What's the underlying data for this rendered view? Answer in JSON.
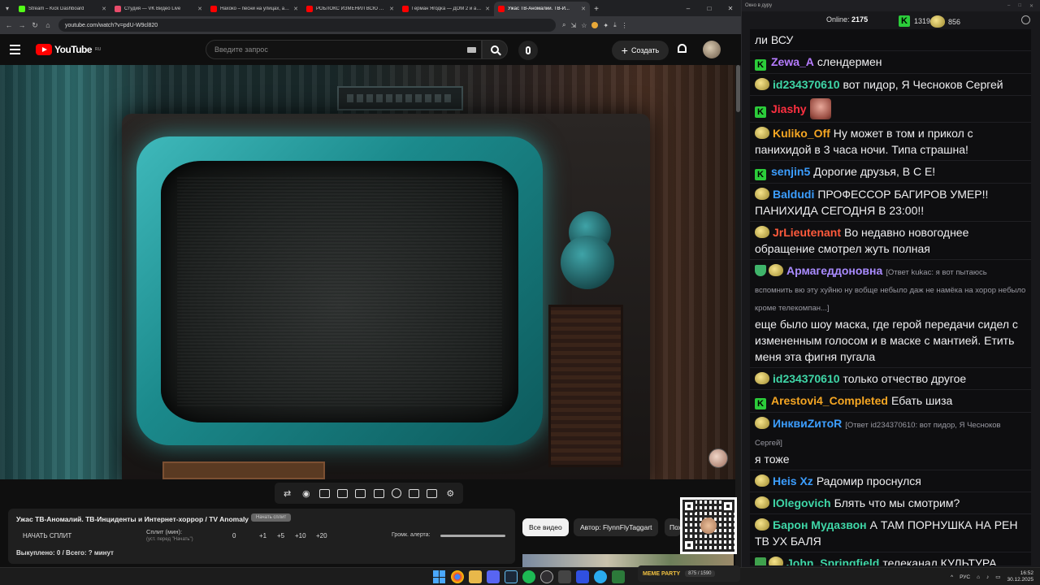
{
  "browser": {
    "tabs": [
      {
        "title": "Stream – Kick Dashboard",
        "color": "#53fc18"
      },
      {
        "title": "Студия — VK Видео Live",
        "color": "#e84c6b"
      },
      {
        "title": "Нахоко – песни на улицах, ар...",
        "color": "#ff0000"
      },
      {
        "title": "РОБЛОКС ИЗМЕНИЛ ВСЮ МО...",
        "color": "#ff0000"
      },
      {
        "title": "Герман Ягодка — ДОМ 2 и ал...",
        "color": "#ff0000"
      },
      {
        "title": "Ужас ТВ-Аномалий. ТВ-И...",
        "color": "#ff0000"
      }
    ],
    "url": "youtube.com/watch?v=pdU-W9cl820"
  },
  "youtube": {
    "logo": "YouTube",
    "region": "RU",
    "search_placeholder": "Введите запрос",
    "create_label": "Создать"
  },
  "split_panel": {
    "title": "Ужас ТВ-Аномалий. ТВ-Инциденты и Интернет-хоррор / TV Anomaly",
    "badge": "Начать сплит",
    "start_label": "НАЧАТЬ СПЛИТ",
    "split_label": "Сплит (мин):",
    "split_sub": "(уст. перед \"Начать\")",
    "split_value": "0",
    "increments": [
      "+1",
      "+5",
      "+10",
      "+20"
    ],
    "volume_label": "Громк. алерта:",
    "bought": "Выкуплено: 0 / Всего: ? минут"
  },
  "chips": {
    "all": "Все видео",
    "author": "Автор: FlynnFlyTaggart",
    "next": "Пох"
  },
  "chat": {
    "window_title": "Окно в дуру",
    "online_label": "Online:",
    "online_value": "2175",
    "kick_count": "1319",
    "other_count": "856",
    "messages": [
      {
        "badge": "none",
        "name": "",
        "color": "#ffffff",
        "text": "ли ВСУ"
      },
      {
        "badge": "k",
        "name": "Zewa_A",
        "color": "#b67cff",
        "text": "слендермен"
      },
      {
        "badge": "face",
        "name": "id234370610",
        "color": "#3fd6a7",
        "text": "вот пидор, Я Чесноков Сергей"
      },
      {
        "badge": "k",
        "name": "Jiashy",
        "color": "#ff3040",
        "text": ""
      },
      {
        "badge": "face",
        "name": "Kuliko_Off",
        "color": "#f5a623",
        "text": "Ну может в том и прикол с панихидой в 3 часа ночи. Типа страшна!"
      },
      {
        "badge": "k",
        "name": "senjin5",
        "color": "#3c9eff",
        "text": "Дорогие друзья, В С Е!"
      },
      {
        "badge": "face",
        "name": "Baldudi",
        "color": "#3c9eff",
        "text": "ПРОФЕССОР БАГИРОВ УМЕР!! ПАНИХИДА СЕГОДНЯ В 23:00!!"
      },
      {
        "badge": "face",
        "name": "JrLieutenant",
        "color": "#ff5a3c",
        "text": "Во недавно новогоднее обращение смотрел жуть полная"
      },
      {
        "badge": "shield",
        "name": "Армагеддоновна",
        "color": "#a98bff",
        "reply": "[Ответ kukac: я вот пытаюсь вспомнить вю эту хуйню ну вобще небыло даж не намёка на хорор небыло кроме телекомпан...]",
        "text": "еще было шоу маска, где герой передачи сидел с измененным голосом и в маске с мантией. Етить меня эта фигня пугала"
      },
      {
        "badge": "face",
        "name": "id234370610",
        "color": "#3fd6a7",
        "text": "только отчество другое"
      },
      {
        "badge": "k",
        "name": "Arestovi4_Completed",
        "color": "#f5a623",
        "text": "Ебать шиза"
      },
      {
        "badge": "face",
        "name": "ИнквиZитоR",
        "color": "#3c9eff",
        "reply": "[Ответ id234370610: вот пидор, Я Чесноков Сергей]",
        "text": "я тоже"
      },
      {
        "badge": "face",
        "name": "Heis Xz",
        "color": "#3c9eff",
        "text": "Радомир проснулся"
      },
      {
        "badge": "face",
        "name": "IOlegovich",
        "color": "#3fd6a7",
        "text": "Блять что мы смотрим?"
      },
      {
        "badge": "face",
        "name": "Барон Мудазвон",
        "color": "#3fd6a7",
        "text": "А ТАМ ПОРНУШКА НА РЕН ТВ УХ БАЛЯ"
      },
      {
        "badge": "pencil",
        "name": "John_Springfield",
        "color": "#3fd6a7",
        "text": "телеканал КУЛЬТУРА"
      }
    ]
  },
  "taskbar": {
    "mp_label": "MEME PARTY",
    "mp_count": "875 / 1590",
    "lang": "РУС",
    "time": "16:52",
    "date": "30.12.2025"
  }
}
